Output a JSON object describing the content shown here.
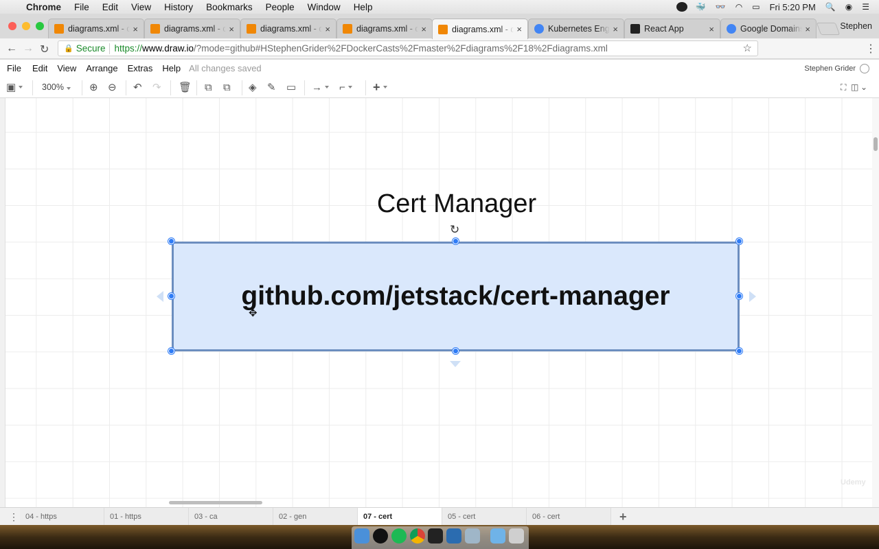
{
  "menubar": {
    "apple": "",
    "app": "Chrome",
    "items": [
      "File",
      "Edit",
      "View",
      "History",
      "Bookmarks",
      "People",
      "Window",
      "Help"
    ],
    "clock": "Fri 5:20 PM"
  },
  "tabs": [
    {
      "title": "diagrams.xml - draw.io",
      "close": "×",
      "favicon": "#f08705"
    },
    {
      "title": "diagrams.xml - draw.io",
      "close": "×",
      "favicon": "#f08705"
    },
    {
      "title": "diagrams.xml - draw.io",
      "close": "×",
      "favicon": "#f08705"
    },
    {
      "title": "diagrams.xml - draw.io",
      "close": "×",
      "favicon": "#f08705"
    },
    {
      "title": "diagrams.xml - draw.io",
      "close": "×",
      "favicon": "#f08705"
    },
    {
      "title": "Kubernetes Engine",
      "close": "×",
      "favicon": "#4285f4"
    },
    {
      "title": "React App",
      "close": "×",
      "favicon": "#222222"
    },
    {
      "title": "Google Domains",
      "close": "×",
      "favicon": "#4285f4"
    }
  ],
  "profile": "Stephen",
  "address": {
    "secure_label": "Secure",
    "scheme": "https://",
    "host": "www.draw.io",
    "path": "/?mode=github#HStephenGrider%2FDockerCasts%2Fmaster%2Fdiagrams%2F18%2Fdiagrams.xml"
  },
  "drawio": {
    "menus": [
      "File",
      "Edit",
      "View",
      "Arrange",
      "Extras",
      "Help"
    ],
    "status": "All changes saved",
    "user": "Stephen Grider",
    "zoom": "300%"
  },
  "diagram": {
    "title": "Cert Manager",
    "box_text": "github.com/jetstack/cert-manager",
    "box_fill": "#dae8fc",
    "box_stroke": "#6c8ebf",
    "selection_color": "#2f7cf6"
  },
  "pages": [
    {
      "label": "04 - https",
      "active": false
    },
    {
      "label": "01 - https",
      "active": false
    },
    {
      "label": "03 - ca",
      "active": false
    },
    {
      "label": "02 - gen",
      "active": false
    },
    {
      "label": "07 - cert",
      "active": true
    },
    {
      "label": "05 - cert",
      "active": false
    },
    {
      "label": "06 - cert",
      "active": false
    }
  ],
  "watermark": "Udemy"
}
